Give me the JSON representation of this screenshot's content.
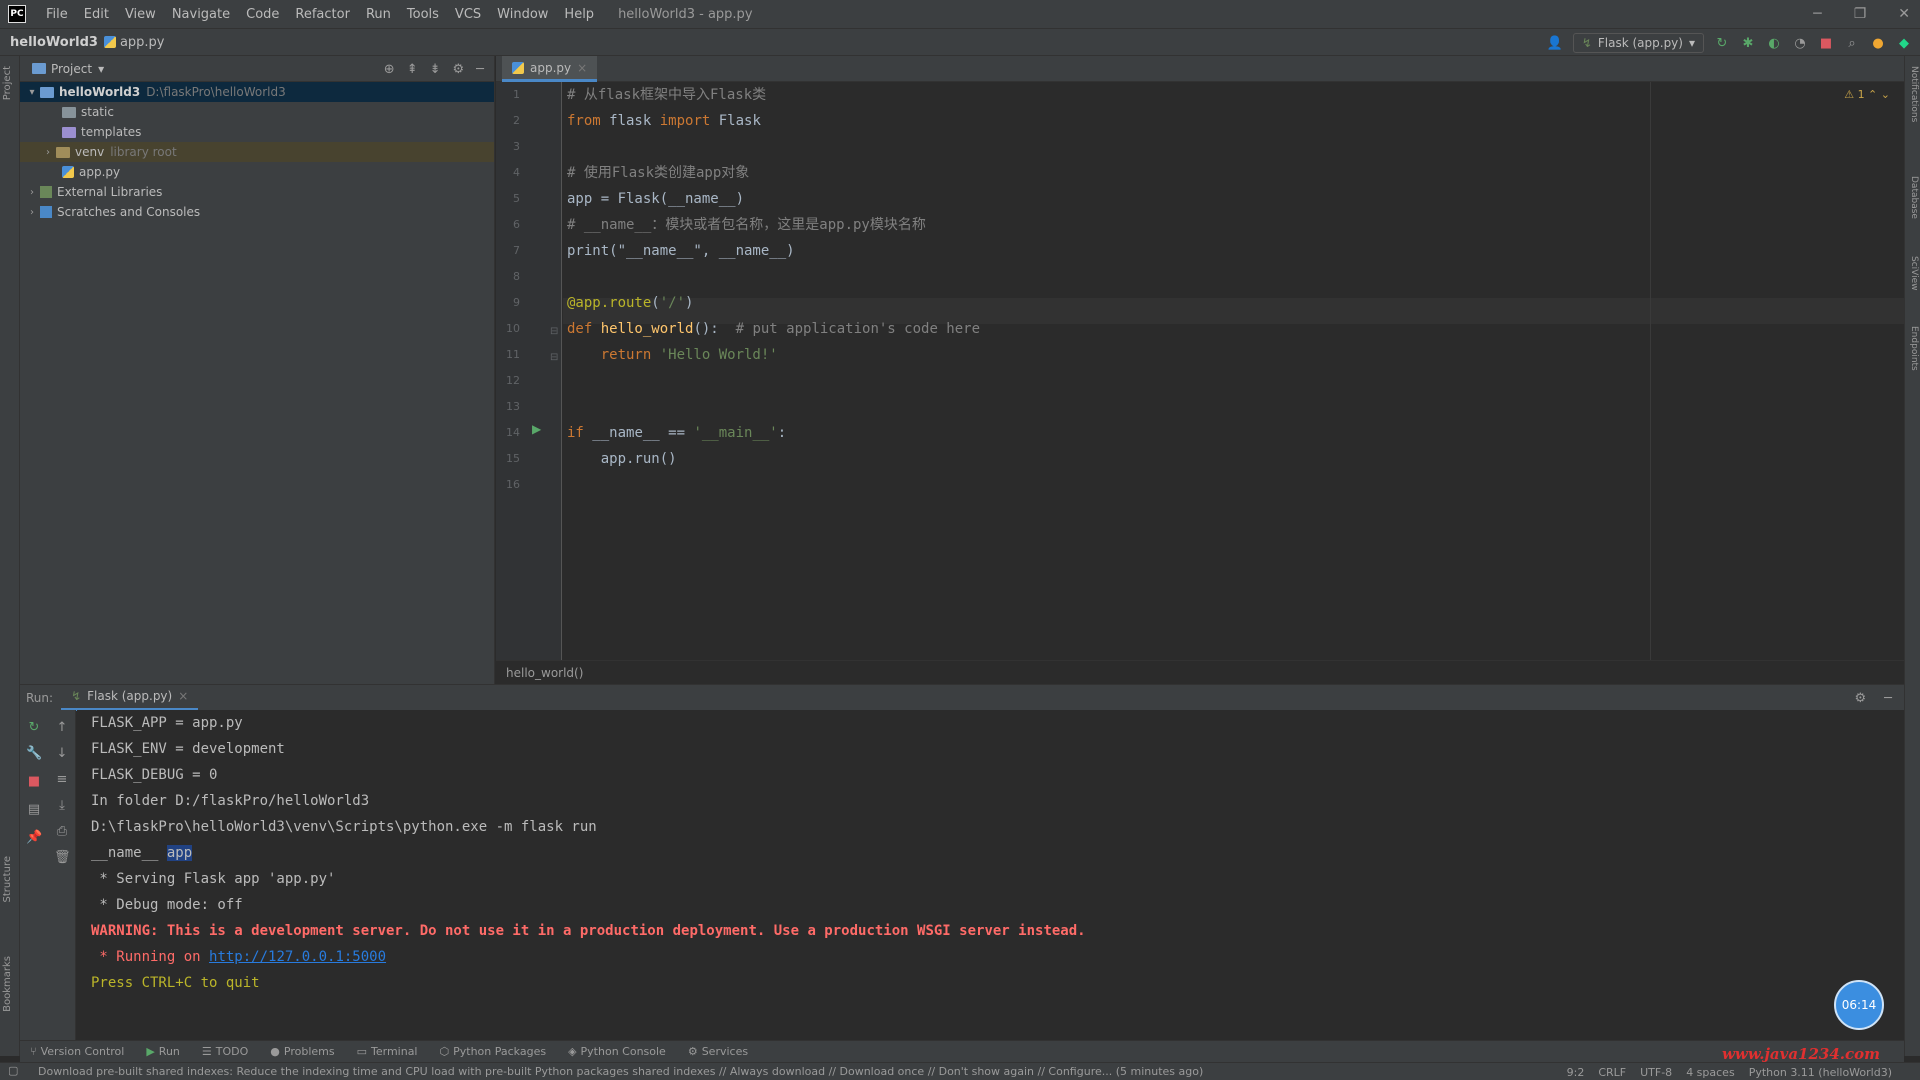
{
  "menubar": {
    "items": [
      "File",
      "Edit",
      "View",
      "Navigate",
      "Code",
      "Refactor",
      "Run",
      "Tools",
      "VCS",
      "Window",
      "Help"
    ],
    "window_title": "helloWorld3 - app.py"
  },
  "navbar": {
    "project": "helloWorld3",
    "file": "app.py",
    "run_config": "Flask (app.py)"
  },
  "left_strip": {
    "project": "Project",
    "structure": "Structure",
    "bookmarks": "Bookmarks"
  },
  "right_strip": {
    "notifications": "Notifications",
    "database": "Database",
    "sciview": "SciView",
    "endpoints": "Endpoints"
  },
  "project_panel": {
    "title": "Project",
    "tree": [
      {
        "label": "helloWorld3",
        "extra": "D:\\flaskPro\\helloWorld3"
      },
      {
        "label": "static",
        "extra": ""
      },
      {
        "label": "templates",
        "extra": ""
      },
      {
        "label": "venv",
        "extra": "library root"
      },
      {
        "label": "app.py",
        "extra": ""
      },
      {
        "label": "External Libraries",
        "extra": ""
      },
      {
        "label": "Scratches and Consoles",
        "extra": ""
      }
    ]
  },
  "editor": {
    "tab": "app.py",
    "breadcrumb": "hello_world()",
    "warning_count": "1",
    "line_numbers": [
      "1",
      "2",
      "3",
      "4",
      "5",
      "6",
      "7",
      "8",
      "9",
      "10",
      "11",
      "12",
      "13",
      "14",
      "15",
      "16"
    ],
    "lines": [
      {
        "c1": "# 从flask框架中导入Flask类"
      },
      {
        "k": "from",
        "p1": " flask ",
        "k2": "import",
        "p2": " Flask"
      },
      {},
      {
        "c1": "# 使用Flask类创建app对象"
      },
      {
        "p1": "app = Flask(__name__)"
      },
      {
        "c1": "# __name__：模块或者包名称，这里是app.py模块名称"
      },
      {
        "p1": "print(\"__name__\", __name__)"
      },
      {},
      {
        "d": "@app.route",
        "p1": "(",
        "s": "'/'",
        "p2": ")"
      },
      {
        "k": "def ",
        "f": "hello_world",
        "p1": "():  ",
        "c1": "# put application's code here"
      },
      {
        "k": "    return ",
        "s": "'Hello World!'"
      },
      {},
      {},
      {
        "k": "if ",
        "p1": "__name__ == ",
        "s": "'__main__'",
        "p2": ":"
      },
      {
        "p1": "    app.run()"
      },
      {}
    ]
  },
  "run_panel": {
    "label": "Run:",
    "tab": "Flask (app.py)",
    "console": {
      "l1": "FLASK_APP = app.py",
      "l2": "FLASK_ENV = development",
      "l3": "FLASK_DEBUG = 0",
      "l4": "In folder D:/flaskPro/helloWorld3",
      "l5": "D:\\flaskPro\\helloWorld3\\venv\\Scripts\\python.exe -m flask run",
      "l6a": "__name__ ",
      "l6b": "app",
      "l7": " * Serving Flask app 'app.py'",
      "l8": " * Debug mode: off",
      "l9": "WARNING: This is a development server. Do not use it in a production deployment. Use a production WSGI server instead.",
      "l10a": " * Running on ",
      "l10b": "http://127.0.0.1:5000",
      "l11": "Press CTRL+C to quit"
    },
    "timer": "06:14"
  },
  "toolwindows": [
    "Version Control",
    "Run",
    "TODO",
    "Problems",
    "Terminal",
    "Python Packages",
    "Python Console",
    "Services"
  ],
  "statusbar": {
    "message": "Download pre-built shared indexes: Reduce the indexing time and CPU load with pre-built Python packages shared indexes // Always download // Download once // Don't show again // Configure... (5 minutes ago)",
    "position": "9:2",
    "line_sep": "CRLF",
    "encoding": "UTF-8",
    "indent": "4 spaces",
    "interpreter": "Python 3.11 (helloWorld3)"
  },
  "watermark": "www.java1234.com"
}
